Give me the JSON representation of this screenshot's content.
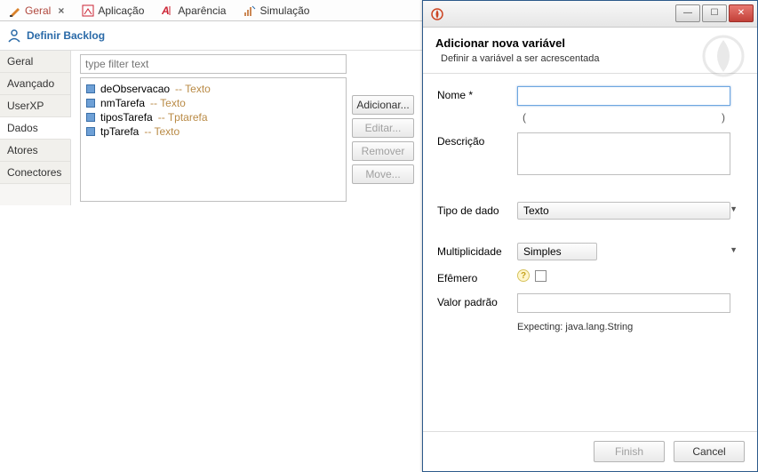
{
  "top_tabs": {
    "geral": "Geral",
    "aplicacao": "Aplicação",
    "aparencia": "Aparência",
    "simulacao": "Simulação"
  },
  "header": {
    "title": "Definir Backlog"
  },
  "sidebar": {
    "geral": "Geral",
    "avancado": "Avançado",
    "userxp": "UserXP",
    "dados": "Dados",
    "atores": "Atores",
    "conectores": "Conectores"
  },
  "filter_placeholder": "type filter text",
  "vars": [
    {
      "name": "deObservacao",
      "type": "Texto"
    },
    {
      "name": "nmTarefa",
      "type": "Texto"
    },
    {
      "name": "tiposTarefa",
      "type": "Tptarefa"
    },
    {
      "name": "tpTarefa",
      "type": "Texto"
    }
  ],
  "buttons": {
    "add": "Adicionar...",
    "edit": "Editar...",
    "remove": "Remover",
    "move": "Move..."
  },
  "dialog": {
    "title": "Adicionar nova variável",
    "subtitle": "Definir a variável a ser acrescentada",
    "labels": {
      "nome": "Nome *",
      "descricao": "Descrição",
      "tipo": "Tipo de dado",
      "mult": "Multiplicidade",
      "efemero": "Efêmero",
      "valor": "Valor padrão"
    },
    "values": {
      "nome": "",
      "tipo": "Texto",
      "mult": "Simples",
      "valor": ""
    },
    "paren_l": "(",
    "paren_r": ")",
    "expecting": "Expecting: java.lang.String",
    "finish": "Finish",
    "cancel": "Cancel"
  }
}
